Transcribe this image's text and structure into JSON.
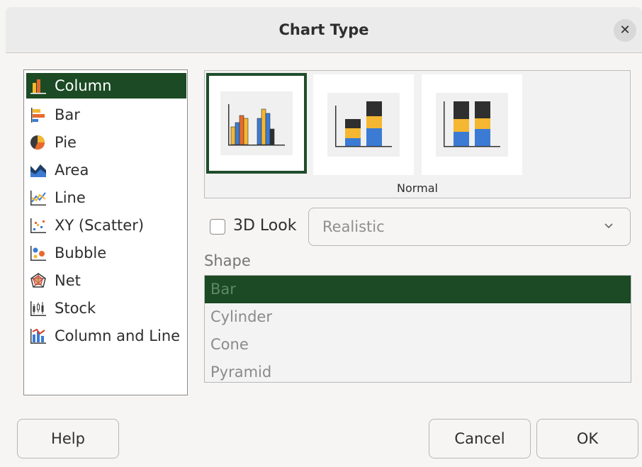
{
  "dialog": {
    "title": "Chart Type"
  },
  "chart_types": [
    {
      "label": "Column",
      "icon": "column-chart-icon",
      "selected": true
    },
    {
      "label": "Bar",
      "icon": "bar-chart-icon"
    },
    {
      "label": "Pie",
      "icon": "pie-chart-icon"
    },
    {
      "label": "Area",
      "icon": "area-chart-icon"
    },
    {
      "label": "Line",
      "icon": "line-chart-icon"
    },
    {
      "label": "XY (Scatter)",
      "icon": "scatter-chart-icon"
    },
    {
      "label": "Bubble",
      "icon": "bubble-chart-icon"
    },
    {
      "label": "Net",
      "icon": "net-chart-icon"
    },
    {
      "label": "Stock",
      "icon": "stock-chart-icon"
    },
    {
      "label": "Column and Line",
      "icon": "column-line-chart-icon"
    }
  ],
  "variants": {
    "caption": "Normal",
    "items": [
      {
        "name": "normal",
        "selected": true
      },
      {
        "name": "stacked"
      },
      {
        "name": "percent-stacked"
      }
    ]
  },
  "options": {
    "look_3d_label": "3D Look",
    "look_3d_checked": false,
    "render_style": "Realistic"
  },
  "shape": {
    "label": "Shape",
    "items": [
      "Bar",
      "Cylinder",
      "Cone",
      "Pyramid"
    ],
    "selected": "Bar"
  },
  "buttons": {
    "help": "Help",
    "cancel": "Cancel",
    "ok": "OK"
  },
  "colors": {
    "selection": "#1b4a24",
    "bar_blue": "#3b7bd4",
    "bar_orange": "#f5b731",
    "bar_dark": "#2f2f2f"
  }
}
